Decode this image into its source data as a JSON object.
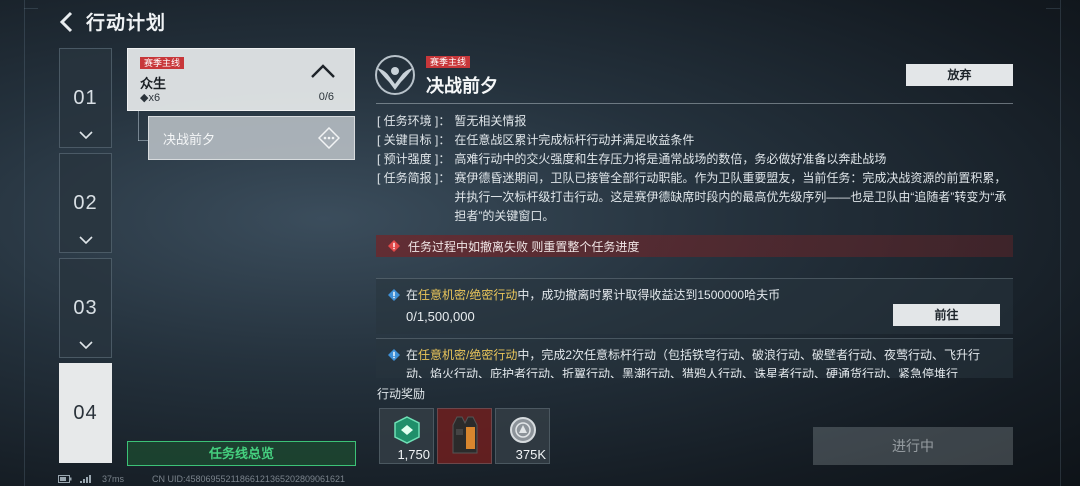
{
  "header": {
    "title": "行动计划"
  },
  "tabs": [
    {
      "label": "01"
    },
    {
      "label": "02"
    },
    {
      "label": "03"
    },
    {
      "label": "04"
    }
  ],
  "storyline": {
    "tag": "赛季主线",
    "name": "众生",
    "count": "◆x6",
    "progress": "0/6",
    "sub_item": "决战前夕"
  },
  "overview_button": "任务线总览",
  "detail": {
    "tag": "赛季主线",
    "title": "决战前夕",
    "give_up": "放弃",
    "info": [
      {
        "key": "[ 任务环境 ]：",
        "value": "暂无相关情报"
      },
      {
        "key": "[ 关键目标 ]：",
        "value": "在任意战区累计完成标杆行动并满足收益条件"
      },
      {
        "key": "[ 预计强度 ]：",
        "value": "高难行动中的交火强度和生存压力将是通常战场的数倍，务必做好准备以奔赴战场"
      },
      {
        "key": "[ 任务简报 ]：",
        "value": "赛伊德昏迷期间，卫队已接管全部行动职能。作为卫队重要盟友，当前任务：完成决战资源的前置积累，并执行一次标杆级打击行动。这是赛伊德缺席时段内的最高优先级序列——也是卫队由“追随者”转变为“承担者”的关键窗口。"
      }
    ],
    "warning": "任务过程中如撤离失败 则重置整个任务进度",
    "tasks": [
      {
        "prefix": "在",
        "highlight": "任意机密/绝密行动",
        "suffix": "中，成功撤离时累计取得收益达到1500000哈夫币",
        "value": "0/1,500,000",
        "button": "前往"
      },
      {
        "prefix": "在",
        "highlight": "任意机密/绝密行动",
        "suffix": "中，完成2次任意标杆行动（包括铁穹行动、破浪行动、破壁者行动、夜莺行动、飞升行动、焰火行动、庇护者行动、折翼行动、黑潮行动、猎鸦人行动、诛星者行动、硬通货行动、紧急停堆行"
      }
    ],
    "reward_label": "行动奖励",
    "rewards": [
      {
        "icon": "green-badge-icon",
        "amount": "1,750"
      },
      {
        "icon": "tactical-vest-icon",
        "amount": ""
      },
      {
        "icon": "silver-coin-icon",
        "amount": "375K"
      }
    ],
    "status_button": "进行中"
  },
  "footer": {
    "ping": "37ms",
    "uid": "CN UID:4580695521186612136520280906162​1"
  }
}
